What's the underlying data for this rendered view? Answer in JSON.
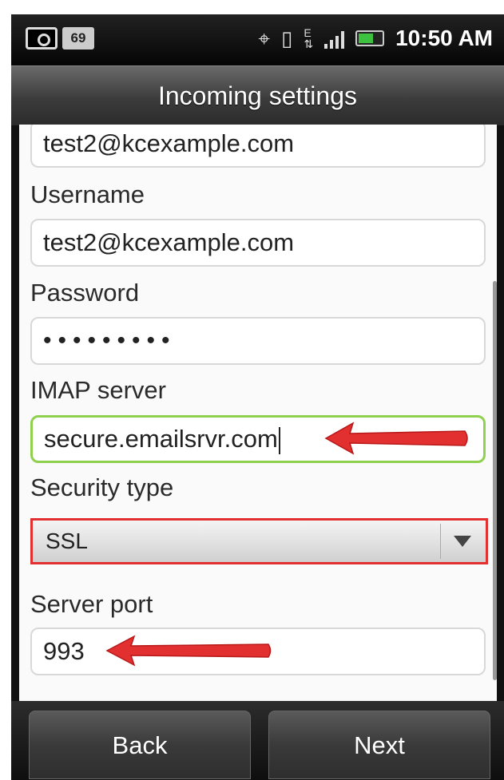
{
  "status_bar": {
    "notification_count": "69",
    "time": "10:50 AM",
    "icons": [
      "camera-icon",
      "gps-icon",
      "vibrate-icon",
      "data-ev-icon",
      "signal-icon",
      "battery-icon"
    ]
  },
  "title": "Incoming settings",
  "form": {
    "email_value": "test2@kcexample.com",
    "username_label": "Username",
    "username_value": "test2@kcexample.com",
    "password_label": "Password",
    "password_value": "•••••••••",
    "imap_label": "IMAP server",
    "imap_value": "secure.emailsrvr.com",
    "security_label": "Security type",
    "security_value": "SSL",
    "port_label": "Server port",
    "port_value": "993"
  },
  "buttons": {
    "back": "Back",
    "next": "Next"
  },
  "colors": {
    "annotation_red": "#e23030",
    "focus_green": "#8fd14f"
  }
}
